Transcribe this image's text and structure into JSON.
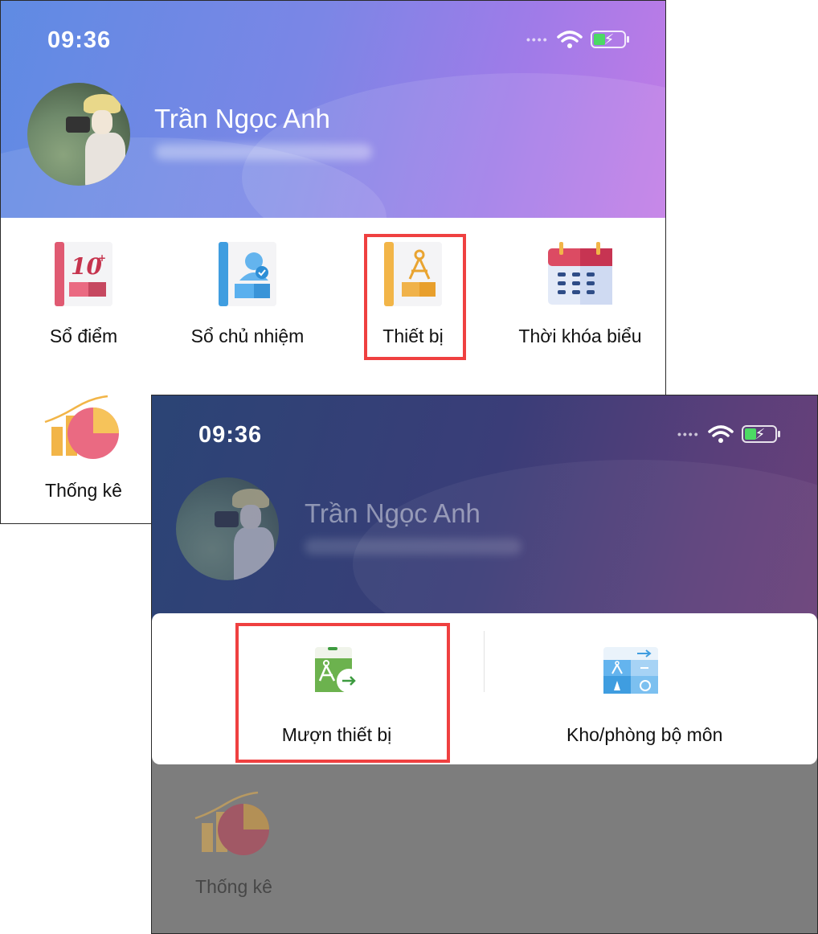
{
  "screen1": {
    "status": {
      "time": "09:36"
    },
    "profile": {
      "name": "Trần Ngọc Anh"
    },
    "menu": [
      {
        "label": "Sổ điểm",
        "icon": "gradebook-icon",
        "badge": "10+"
      },
      {
        "label": "Sổ chủ nhiệm",
        "icon": "homeroom-book-icon"
      },
      {
        "label": "Thiết bị",
        "icon": "equipment-icon"
      },
      {
        "label": "Thời khóa biểu",
        "icon": "calendar-icon"
      },
      {
        "label": "Thống kê",
        "icon": "statistics-icon"
      }
    ]
  },
  "screen2": {
    "status": {
      "time": "09:36"
    },
    "profile": {
      "name": "Trần Ngọc Anh"
    },
    "sheet": [
      {
        "label": "Mượn thiết bị",
        "icon": "borrow-equipment-icon"
      },
      {
        "label": "Kho/phòng bộ môn",
        "icon": "storage-room-icon"
      }
    ],
    "menu": [
      {
        "label": "Thống kê",
        "icon": "statistics-icon"
      }
    ]
  },
  "colors": {
    "highlight": "#ef4040",
    "header_start": "#5f8be3",
    "header_end": "#c27be6",
    "battery_fill": "#4cd964"
  }
}
